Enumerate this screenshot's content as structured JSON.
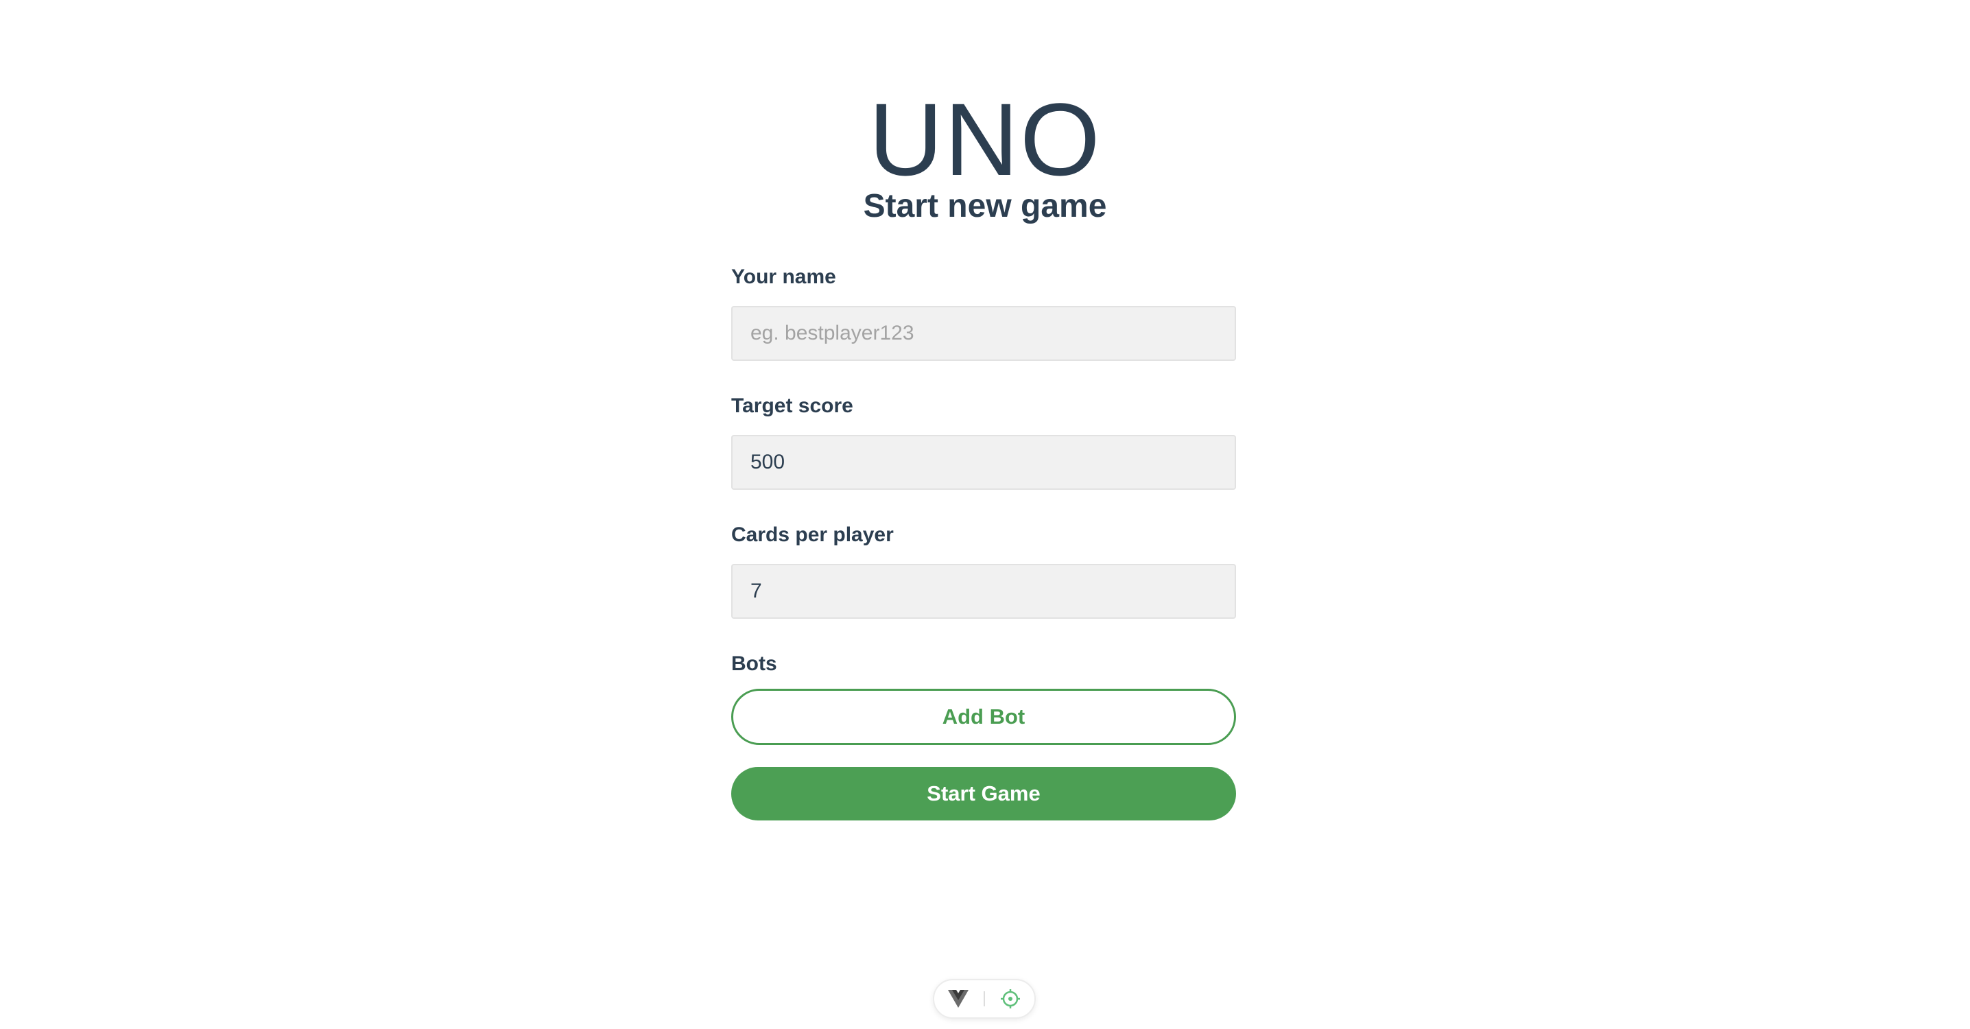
{
  "header": {
    "title": "UNO",
    "subtitle": "Start new game"
  },
  "form": {
    "name": {
      "label": "Your name",
      "value": "",
      "placeholder": "eg. bestplayer123"
    },
    "target_score": {
      "label": "Target score",
      "value": "500"
    },
    "cards_per_player": {
      "label": "Cards per player",
      "value": "7"
    },
    "bots": {
      "label": "Bots",
      "add_button_label": "Add Bot"
    },
    "start_button_label": "Start Game"
  },
  "devtools": {
    "icons": [
      "vue-logo-icon",
      "crosshair-icon"
    ]
  },
  "colors": {
    "text": "#2c3e50",
    "accent": "#4c9f54",
    "input_bg": "#f1f1f1"
  }
}
